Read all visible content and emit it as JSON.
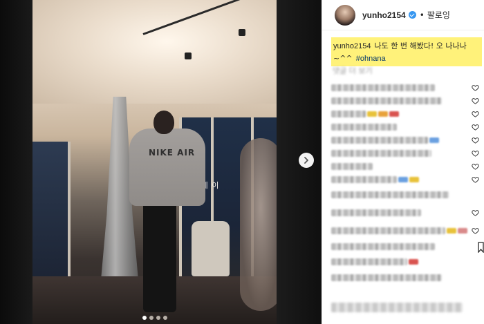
{
  "post": {
    "media": {
      "shirt_print": "NIKE AIR",
      "window_sign": "손 네 이",
      "carousel_dots": 4,
      "active_dot": 0
    },
    "author": {
      "username": "yunho2154",
      "verified": true,
      "separator": "•",
      "follow_label": "팔로잉"
    },
    "caption": {
      "username": "yunho2154",
      "text": "나도 한 번 해봤다! 오 나나나 ~^^",
      "hashtag": "#ohnana",
      "highlight_color": "#fff27a"
    },
    "more_comments_label": "댓글 더 보기",
    "comments": [
      {
        "obscured": true,
        "tints": []
      },
      {
        "obscured": true,
        "tints": []
      },
      {
        "obscured": true,
        "tints": [
          "#e8c23a",
          "#e8a23a",
          "#d9534f"
        ]
      },
      {
        "obscured": true,
        "tints": []
      },
      {
        "obscured": true,
        "tints": [
          "#6aa0e0"
        ]
      },
      {
        "obscured": true,
        "tints": []
      },
      {
        "obscured": true,
        "tints": []
      },
      {
        "obscured": true,
        "tints": [
          "#6aa0e0",
          "#e8c23a"
        ]
      },
      {
        "obscured": true,
        "tints": []
      },
      {
        "obscured": true,
        "tints": []
      },
      {
        "obscured": true,
        "tints": [
          "#e8c23a",
          "#d98a8a"
        ]
      },
      {
        "obscured": true,
        "tints": []
      },
      {
        "obscured": true,
        "tints": [
          "#d9534f"
        ]
      },
      {
        "obscured": true,
        "tints": []
      }
    ]
  },
  "colors": {
    "accent_blue": "#3897f0",
    "text": "#262626",
    "muted": "#9a9a9a"
  },
  "icons": {
    "next": "chevron-right-icon",
    "like": "heart-icon",
    "verified": "verified-badge-icon",
    "side": "bookmark-icon"
  }
}
